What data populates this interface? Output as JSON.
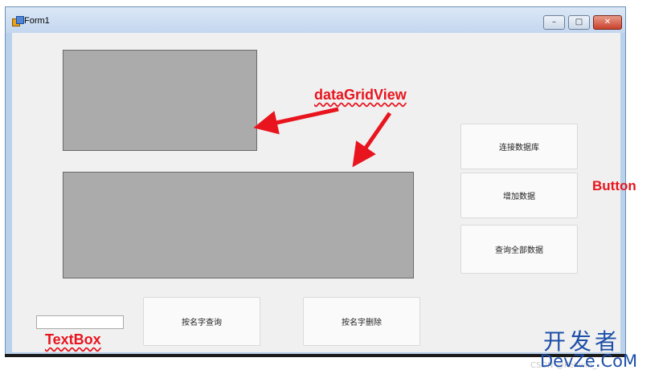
{
  "window": {
    "title": "Form1",
    "controls": {
      "minimize": "–",
      "maximize": "□",
      "close": "✕"
    }
  },
  "buttons": {
    "connect_db": "连接数据库",
    "add_data": "增加数据",
    "query_all": "查询全部数据",
    "query_by_name": "按名字查询",
    "delete_by_name": "按名字删除"
  },
  "textbox": {
    "value": ""
  },
  "annotations": {
    "datagridview": "dataGridView",
    "button": "Button",
    "textbox": "TextBox",
    "color": "#e8141e"
  },
  "watermark": {
    "line1": "开发者",
    "line2": "DevZe.CoM",
    "line3": "CSDN @Kehwin_"
  },
  "icons": [
    "form-app-icon",
    "minimize-icon",
    "maximize-icon",
    "close-icon",
    "arrow-icon"
  ]
}
